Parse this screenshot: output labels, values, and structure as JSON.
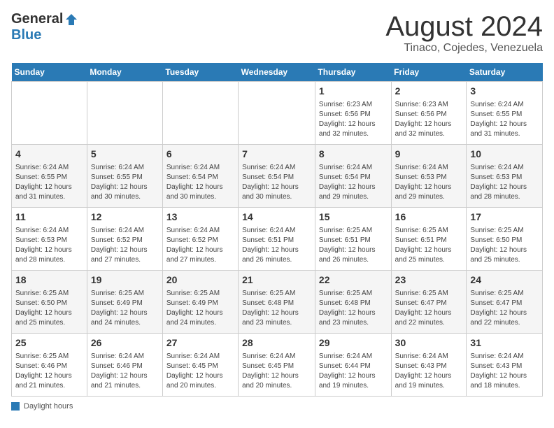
{
  "header": {
    "logo_general": "General",
    "logo_blue": "Blue",
    "main_title": "August 2024",
    "subtitle": "Tinaco, Cojedes, Venezuela"
  },
  "days_of_week": [
    "Sunday",
    "Monday",
    "Tuesday",
    "Wednesday",
    "Thursday",
    "Friday",
    "Saturday"
  ],
  "weeks": [
    [
      {
        "day": "",
        "detail": ""
      },
      {
        "day": "",
        "detail": ""
      },
      {
        "day": "",
        "detail": ""
      },
      {
        "day": "",
        "detail": ""
      },
      {
        "day": "1",
        "detail": "Sunrise: 6:23 AM\nSunset: 6:56 PM\nDaylight: 12 hours\nand 32 minutes."
      },
      {
        "day": "2",
        "detail": "Sunrise: 6:23 AM\nSunset: 6:56 PM\nDaylight: 12 hours\nand 32 minutes."
      },
      {
        "day": "3",
        "detail": "Sunrise: 6:24 AM\nSunset: 6:55 PM\nDaylight: 12 hours\nand 31 minutes."
      }
    ],
    [
      {
        "day": "4",
        "detail": "Sunrise: 6:24 AM\nSunset: 6:55 PM\nDaylight: 12 hours\nand 31 minutes."
      },
      {
        "day": "5",
        "detail": "Sunrise: 6:24 AM\nSunset: 6:55 PM\nDaylight: 12 hours\nand 30 minutes."
      },
      {
        "day": "6",
        "detail": "Sunrise: 6:24 AM\nSunset: 6:54 PM\nDaylight: 12 hours\nand 30 minutes."
      },
      {
        "day": "7",
        "detail": "Sunrise: 6:24 AM\nSunset: 6:54 PM\nDaylight: 12 hours\nand 30 minutes."
      },
      {
        "day": "8",
        "detail": "Sunrise: 6:24 AM\nSunset: 6:54 PM\nDaylight: 12 hours\nand 29 minutes."
      },
      {
        "day": "9",
        "detail": "Sunrise: 6:24 AM\nSunset: 6:53 PM\nDaylight: 12 hours\nand 29 minutes."
      },
      {
        "day": "10",
        "detail": "Sunrise: 6:24 AM\nSunset: 6:53 PM\nDaylight: 12 hours\nand 28 minutes."
      }
    ],
    [
      {
        "day": "11",
        "detail": "Sunrise: 6:24 AM\nSunset: 6:53 PM\nDaylight: 12 hours\nand 28 minutes."
      },
      {
        "day": "12",
        "detail": "Sunrise: 6:24 AM\nSunset: 6:52 PM\nDaylight: 12 hours\nand 27 minutes."
      },
      {
        "day": "13",
        "detail": "Sunrise: 6:24 AM\nSunset: 6:52 PM\nDaylight: 12 hours\nand 27 minutes."
      },
      {
        "day": "14",
        "detail": "Sunrise: 6:24 AM\nSunset: 6:51 PM\nDaylight: 12 hours\nand 26 minutes."
      },
      {
        "day": "15",
        "detail": "Sunrise: 6:25 AM\nSunset: 6:51 PM\nDaylight: 12 hours\nand 26 minutes."
      },
      {
        "day": "16",
        "detail": "Sunrise: 6:25 AM\nSunset: 6:51 PM\nDaylight: 12 hours\nand 25 minutes."
      },
      {
        "day": "17",
        "detail": "Sunrise: 6:25 AM\nSunset: 6:50 PM\nDaylight: 12 hours\nand 25 minutes."
      }
    ],
    [
      {
        "day": "18",
        "detail": "Sunrise: 6:25 AM\nSunset: 6:50 PM\nDaylight: 12 hours\nand 25 minutes."
      },
      {
        "day": "19",
        "detail": "Sunrise: 6:25 AM\nSunset: 6:49 PM\nDaylight: 12 hours\nand 24 minutes."
      },
      {
        "day": "20",
        "detail": "Sunrise: 6:25 AM\nSunset: 6:49 PM\nDaylight: 12 hours\nand 24 minutes."
      },
      {
        "day": "21",
        "detail": "Sunrise: 6:25 AM\nSunset: 6:48 PM\nDaylight: 12 hours\nand 23 minutes."
      },
      {
        "day": "22",
        "detail": "Sunrise: 6:25 AM\nSunset: 6:48 PM\nDaylight: 12 hours\nand 23 minutes."
      },
      {
        "day": "23",
        "detail": "Sunrise: 6:25 AM\nSunset: 6:47 PM\nDaylight: 12 hours\nand 22 minutes."
      },
      {
        "day": "24",
        "detail": "Sunrise: 6:25 AM\nSunset: 6:47 PM\nDaylight: 12 hours\nand 22 minutes."
      }
    ],
    [
      {
        "day": "25",
        "detail": "Sunrise: 6:25 AM\nSunset: 6:46 PM\nDaylight: 12 hours\nand 21 minutes."
      },
      {
        "day": "26",
        "detail": "Sunrise: 6:24 AM\nSunset: 6:46 PM\nDaylight: 12 hours\nand 21 minutes."
      },
      {
        "day": "27",
        "detail": "Sunrise: 6:24 AM\nSunset: 6:45 PM\nDaylight: 12 hours\nand 20 minutes."
      },
      {
        "day": "28",
        "detail": "Sunrise: 6:24 AM\nSunset: 6:45 PM\nDaylight: 12 hours\nand 20 minutes."
      },
      {
        "day": "29",
        "detail": "Sunrise: 6:24 AM\nSunset: 6:44 PM\nDaylight: 12 hours\nand 19 minutes."
      },
      {
        "day": "30",
        "detail": "Sunrise: 6:24 AM\nSunset: 6:43 PM\nDaylight: 12 hours\nand 19 minutes."
      },
      {
        "day": "31",
        "detail": "Sunrise: 6:24 AM\nSunset: 6:43 PM\nDaylight: 12 hours\nand 18 minutes."
      }
    ]
  ],
  "footer": {
    "note": "Daylight hours"
  }
}
